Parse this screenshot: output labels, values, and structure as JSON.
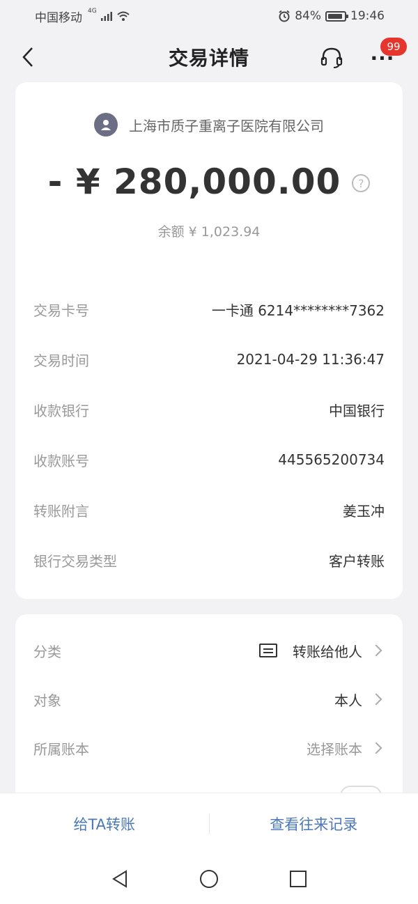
{
  "status_bar": {
    "carrier": "中国移动",
    "network": "4G",
    "battery": "84%",
    "time": "19:46"
  },
  "nav": {
    "title": "交易详情",
    "more_label": "···",
    "badge": "99"
  },
  "summary": {
    "merchant": "上海市质子重离子医院有限公司",
    "amount": "- ¥ 280,000.00",
    "help_glyph": "?",
    "balance": "余额 ¥ 1,023.94"
  },
  "details": [
    {
      "label": "交易卡号",
      "value": "一卡通 6214********7362"
    },
    {
      "label": "交易时间",
      "value": "2021-04-29 11:36:47"
    },
    {
      "label": "收款银行",
      "value": "中国银行"
    },
    {
      "label": "收款账号",
      "value": "445565200734"
    },
    {
      "label": "转账附言",
      "value": "姜玉冲"
    },
    {
      "label": "银行交易类型",
      "value": "客户转账"
    }
  ],
  "categories": [
    {
      "label": "分类",
      "value": "转账给他人",
      "icon": "transfer-icon"
    },
    {
      "label": "对象",
      "value": "本人"
    },
    {
      "label": "所属账本",
      "value": "选择账本"
    }
  ],
  "bottom_actions": {
    "left": "给TA转账",
    "right": "查看往来记录"
  },
  "colors": {
    "accent": "#4a78b8",
    "badge": "#e5352d",
    "background": "#f2f2f4"
  }
}
